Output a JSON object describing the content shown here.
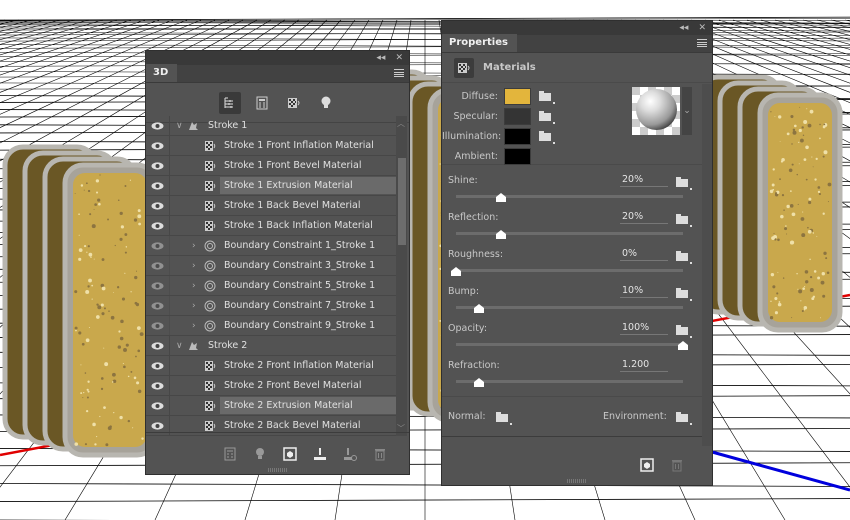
{
  "scene": {
    "letters": [
      "P",
      "P",
      "Y"
    ],
    "axis_colors": {
      "x": "#e00000",
      "z": "#0000dd"
    },
    "material_gold": "#c9a84c"
  },
  "panel3d": {
    "tab": "3D",
    "collapse_glyph": "◂◂",
    "close_glyph": "✕",
    "filters": [
      {
        "name": "whole-scene",
        "active": true
      },
      {
        "name": "meshes",
        "active": false
      },
      {
        "name": "materials",
        "active": false
      },
      {
        "name": "lights",
        "active": false
      }
    ],
    "rows": [
      {
        "label": "Stroke 1",
        "type": "mesh",
        "level": 0,
        "expanded": true,
        "visible": true
      },
      {
        "label": "Stroke 1 Front Inflation Material",
        "type": "material",
        "level": 1,
        "visible": true
      },
      {
        "label": "Stroke 1 Front Bevel Material",
        "type": "material",
        "level": 1,
        "visible": true
      },
      {
        "label": "Stroke 1 Extrusion Material",
        "type": "material",
        "level": 1,
        "visible": true,
        "selected": true
      },
      {
        "label": "Stroke 1 Back Bevel Material",
        "type": "material",
        "level": 1,
        "visible": true
      },
      {
        "label": "Stroke 1 Back Inflation Material",
        "type": "material",
        "level": 1,
        "visible": true
      },
      {
        "label": "Boundary Constraint 1_Stroke 1",
        "type": "constraint",
        "level": 1,
        "visible": false
      },
      {
        "label": "Boundary Constraint 3_Stroke 1",
        "type": "constraint",
        "level": 1,
        "visible": false
      },
      {
        "label": "Boundary Constraint 5_Stroke 1",
        "type": "constraint",
        "level": 1,
        "visible": false
      },
      {
        "label": "Boundary Constraint 7_Stroke 1",
        "type": "constraint",
        "level": 1,
        "visible": false
      },
      {
        "label": "Boundary Constraint 9_Stroke 1",
        "type": "constraint",
        "level": 1,
        "visible": false
      },
      {
        "label": "Stroke 2",
        "type": "mesh",
        "level": 0,
        "expanded": true,
        "visible": true
      },
      {
        "label": "Stroke 2 Front Inflation Material",
        "type": "material",
        "level": 1,
        "visible": true
      },
      {
        "label": "Stroke 2 Front Bevel Material",
        "type": "material",
        "level": 1,
        "visible": true
      },
      {
        "label": "Stroke 2 Extrusion Material",
        "type": "material",
        "level": 1,
        "visible": true,
        "selected": true
      },
      {
        "label": "Stroke 2 Back Bevel Material",
        "type": "material",
        "level": 1,
        "visible": true
      }
    ],
    "footer_icons": [
      "add-mesh-icon",
      "add-light-icon",
      "render-icon",
      "drop-to-plane-icon",
      "remove-constraint-icon",
      "trash-icon"
    ]
  },
  "properties": {
    "tab": "Properties",
    "collapse_glyph": "◂◂",
    "close_glyph": "✕",
    "section": "Materials",
    "colors": [
      {
        "label": "Diffuse:",
        "color": "#e3b53c",
        "has_texture": true
      },
      {
        "label": "Specular:",
        "color": "#343434",
        "has_texture": true
      },
      {
        "label": "Illumination:",
        "color": "#000000",
        "has_texture": true
      },
      {
        "label": "Ambient:",
        "color": "#000000",
        "has_texture": false
      }
    ],
    "sliders": [
      {
        "label": "Shine:",
        "value": "20%",
        "fraction": 0.2,
        "has_texture": true
      },
      {
        "label": "Reflection:",
        "value": "20%",
        "fraction": 0.2,
        "has_texture": true
      },
      {
        "label": "Roughness:",
        "value": "0%",
        "fraction": 0.0,
        "has_texture": true
      },
      {
        "label": "Bump:",
        "value": "10%",
        "fraction": 0.1,
        "has_texture": true
      },
      {
        "label": "Opacity:",
        "value": "100%",
        "fraction": 1.0,
        "has_texture": true
      },
      {
        "label": "Refraction:",
        "value": "1.200",
        "fraction": 0.1,
        "has_texture": false
      }
    ],
    "maps": {
      "normal": "Normal:",
      "environment": "Environment:"
    },
    "chevron": "⌄"
  }
}
